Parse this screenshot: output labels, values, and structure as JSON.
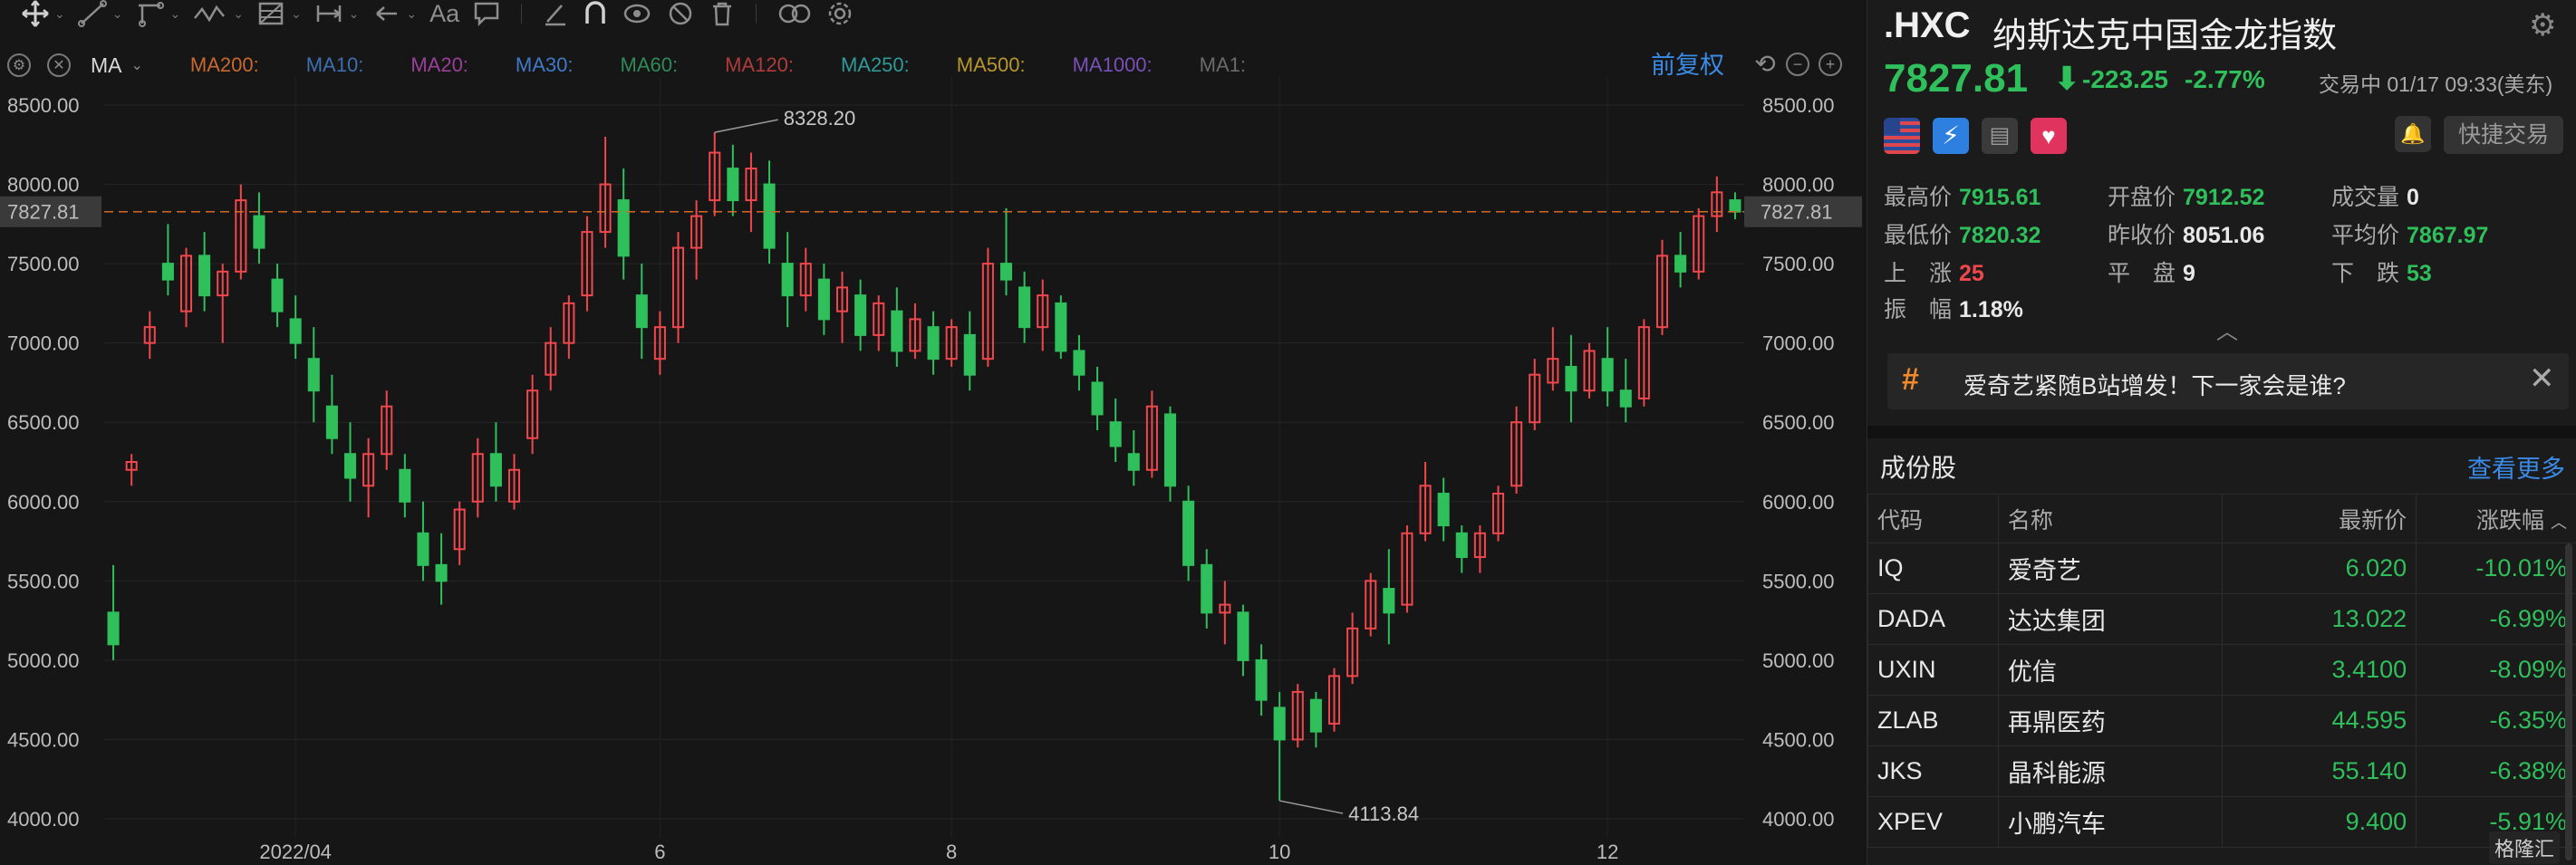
{
  "toolbar": {
    "tools": [
      "crosshair-icon",
      "line-icon",
      "channel-icon",
      "wave-icon",
      "fib-icon",
      "measure-icon",
      "arrow-icon",
      "text-icon",
      "comment-icon",
      "pen-icon",
      "magnet-icon",
      "eye-icon",
      "hide-icon",
      "trash-icon",
      "link-icon",
      "settings-icon"
    ],
    "text_tool_label": "Aa"
  },
  "ma_bar": {
    "selected": "MA",
    "items": [
      {
        "label": "MA200:",
        "color": "#c7682e"
      },
      {
        "label": "MA10:",
        "color": "#3b6fb0"
      },
      {
        "label": "MA20:",
        "color": "#9a3f9a"
      },
      {
        "label": "MA30:",
        "color": "#3f79c8"
      },
      {
        "label": "MA60:",
        "color": "#2e8a57"
      },
      {
        "label": "MA120:",
        "color": "#b03c3c"
      },
      {
        "label": "MA250:",
        "color": "#2f9a9a"
      },
      {
        "label": "MA500:",
        "color": "#b8962e"
      },
      {
        "label": "MA1000:",
        "color": "#7a4fb8"
      },
      {
        "label": "MA1:",
        "color": "#6a6a6a"
      }
    ],
    "adjust_label": "前复权"
  },
  "chart_data": {
    "type": "candlestick",
    "title": "",
    "y_ticks": [
      "8500.00",
      "8000.00",
      "7500.00",
      "7000.00",
      "6500.00",
      "6000.00",
      "5500.00",
      "5000.00",
      "4500.00",
      "4000.00"
    ],
    "x_ticks": [
      "2022/04",
      "6",
      "8",
      "10",
      "12"
    ],
    "ylim": [
      3880,
      8620
    ],
    "current_price_line": 7827.81,
    "current_price_label": "7827.81",
    "high_annotation": {
      "label": "8328.20",
      "value": 8328.2
    },
    "low_annotation": {
      "label": "4113.84",
      "value": 4113.84
    },
    "up_color": "#f0474c",
    "down_color": "#2fbf5b",
    "candles_ohlc_by_period": [
      [
        5300,
        5600,
        5000,
        5100
      ],
      [
        6200,
        6300,
        6100,
        6250
      ],
      [
        7000,
        7200,
        6900,
        7100
      ],
      [
        7500,
        7750,
        7300,
        7400
      ],
      [
        7200,
        7600,
        7100,
        7550
      ],
      [
        7550,
        7700,
        7200,
        7300
      ],
      [
        7300,
        7500,
        7000,
        7450
      ],
      [
        7450,
        8000,
        7400,
        7900
      ],
      [
        7800,
        7950,
        7500,
        7600
      ],
      [
        7400,
        7500,
        7100,
        7200
      ],
      [
        7150,
        7300,
        6900,
        7000
      ],
      [
        6900,
        7100,
        6500,
        6700
      ],
      [
        6600,
        6800,
        6300,
        6400
      ],
      [
        6300,
        6500,
        6000,
        6150
      ],
      [
        6100,
        6400,
        5900,
        6300
      ],
      [
        6300,
        6700,
        6200,
        6600
      ],
      [
        6200,
        6300,
        5900,
        6000
      ],
      [
        5800,
        6000,
        5500,
        5600
      ],
      [
        5600,
        5800,
        5350,
        5500
      ],
      [
        5700,
        6000,
        5600,
        5950
      ],
      [
        6000,
        6400,
        5900,
        6300
      ],
      [
        6300,
        6500,
        6000,
        6100
      ],
      [
        6000,
        6300,
        5950,
        6200
      ],
      [
        6400,
        6800,
        6300,
        6700
      ],
      [
        6800,
        7100,
        6700,
        7000
      ],
      [
        7000,
        7300,
        6900,
        7250
      ],
      [
        7300,
        7800,
        7200,
        7700
      ],
      [
        7700,
        8300,
        7600,
        8000
      ],
      [
        7900,
        8100,
        7400,
        7550
      ],
      [
        7300,
        7500,
        6900,
        7100
      ],
      [
        6900,
        7200,
        6800,
        7100
      ],
      [
        7100,
        7700,
        7000,
        7600
      ],
      [
        7600,
        7900,
        7400,
        7800
      ],
      [
        7900,
        8328,
        7800,
        8200
      ],
      [
        8100,
        8250,
        7800,
        7900
      ],
      [
        7900,
        8200,
        7700,
        8100
      ],
      [
        8000,
        8150,
        7500,
        7600
      ],
      [
        7500,
        7700,
        7100,
        7300
      ],
      [
        7300,
        7600,
        7200,
        7500
      ],
      [
        7400,
        7500,
        7050,
        7150
      ],
      [
        7200,
        7450,
        7000,
        7350
      ],
      [
        7300,
        7400,
        6950,
        7050
      ],
      [
        7050,
        7300,
        6950,
        7250
      ],
      [
        7200,
        7350,
        6850,
        6950
      ],
      [
        6950,
        7250,
        6900,
        7150
      ],
      [
        7100,
        7200,
        6800,
        6900
      ],
      [
        6900,
        7150,
        6850,
        7100
      ],
      [
        7050,
        7200,
        6700,
        6800
      ],
      [
        6900,
        7600,
        6850,
        7500
      ],
      [
        7500,
        7850,
        7300,
        7400
      ],
      [
        7350,
        7450,
        7000,
        7100
      ],
      [
        7100,
        7400,
        6950,
        7300
      ],
      [
        7250,
        7300,
        6900,
        6950
      ],
      [
        6950,
        7050,
        6700,
        6800
      ],
      [
        6750,
        6850,
        6450,
        6550
      ],
      [
        6500,
        6650,
        6250,
        6350
      ],
      [
        6300,
        6450,
        6100,
        6200
      ],
      [
        6200,
        6700,
        6150,
        6600
      ],
      [
        6550,
        6600,
        6000,
        6100
      ],
      [
        6000,
        6100,
        5500,
        5600
      ],
      [
        5600,
        5700,
        5200,
        5300
      ],
      [
        5300,
        5500,
        5100,
        5350
      ],
      [
        5300,
        5350,
        4900,
        5000
      ],
      [
        5000,
        5100,
        4650,
        4750
      ],
      [
        4700,
        4800,
        4114,
        4500
      ],
      [
        4500,
        4850,
        4450,
        4800
      ],
      [
        4750,
        4800,
        4450,
        4550
      ],
      [
        4600,
        4950,
        4550,
        4900
      ],
      [
        4900,
        5300,
        4850,
        5200
      ],
      [
        5200,
        5550,
        5150,
        5500
      ],
      [
        5450,
        5700,
        5100,
        5300
      ],
      [
        5350,
        5850,
        5300,
        5800
      ],
      [
        5800,
        6250,
        5750,
        6100
      ],
      [
        6050,
        6150,
        5750,
        5850
      ],
      [
        5800,
        5850,
        5550,
        5650
      ],
      [
        5650,
        5850,
        5550,
        5800
      ],
      [
        5800,
        6100,
        5750,
        6050
      ],
      [
        6100,
        6600,
        6050,
        6500
      ],
      [
        6500,
        6900,
        6450,
        6800
      ],
      [
        6750,
        7100,
        6700,
        6900
      ],
      [
        6850,
        7050,
        6500,
        6700
      ],
      [
        6700,
        7000,
        6650,
        6950
      ],
      [
        6900,
        7100,
        6600,
        6700
      ],
      [
        6700,
        6900,
        6500,
        6600
      ],
      [
        6650,
        7150,
        6600,
        7100
      ],
      [
        7100,
        7650,
        7050,
        7550
      ],
      [
        7550,
        7700,
        7350,
        7450
      ],
      [
        7450,
        7850,
        7400,
        7800
      ],
      [
        7800,
        8050,
        7700,
        7950
      ],
      [
        7900,
        7950,
        7780,
        7828
      ]
    ]
  },
  "quote": {
    "code": ".HXC",
    "name": "纳斯达克中国金龙指数",
    "last": "7827.81",
    "change": "-223.25",
    "change_pct": "-2.77%",
    "status": "交易中 01/17 09:33(美东)",
    "quick_trade": "快捷交易",
    "stats": [
      {
        "label": "最高价",
        "value": "7915.61",
        "color": "green"
      },
      {
        "label": "开盘价",
        "value": "7912.52",
        "color": "green"
      },
      {
        "label": "成交量",
        "value": "0",
        "color": "white"
      },
      {
        "label": "最低价",
        "value": "7820.32",
        "color": "green"
      },
      {
        "label": "昨收价",
        "value": "8051.06",
        "color": "white"
      },
      {
        "label": "平均价",
        "value": "7867.97",
        "color": "green"
      },
      {
        "label": "上　涨",
        "value": "25",
        "color": "red"
      },
      {
        "label": "平　盘",
        "value": "9",
        "color": "white"
      },
      {
        "label": "下　跌",
        "value": "53",
        "color": "green"
      },
      {
        "label": "振　幅",
        "value": "1.18%",
        "color": "white"
      }
    ]
  },
  "news": {
    "text": "爱奇艺紧随B站增发！下一家会是谁?"
  },
  "constituents": {
    "title": "成份股",
    "view_more": "查看更多",
    "headers": [
      "代码",
      "名称",
      "最新价",
      "涨跌幅"
    ],
    "rows": [
      [
        "IQ",
        "爱奇艺",
        "6.020",
        "-10.01%"
      ],
      [
        "DADA",
        "达达集团",
        "13.022",
        "-6.99%"
      ],
      [
        "UXIN",
        "优信",
        "3.4100",
        "-8.09%"
      ],
      [
        "ZLAB",
        "再鼎医药",
        "44.595",
        "-6.35%"
      ],
      [
        "JKS",
        "晶科能源",
        "55.140",
        "-6.38%"
      ],
      [
        "XPEV",
        "小鹏汽车",
        "9.400",
        "-5.91%"
      ]
    ]
  },
  "watermark": "格隆汇"
}
